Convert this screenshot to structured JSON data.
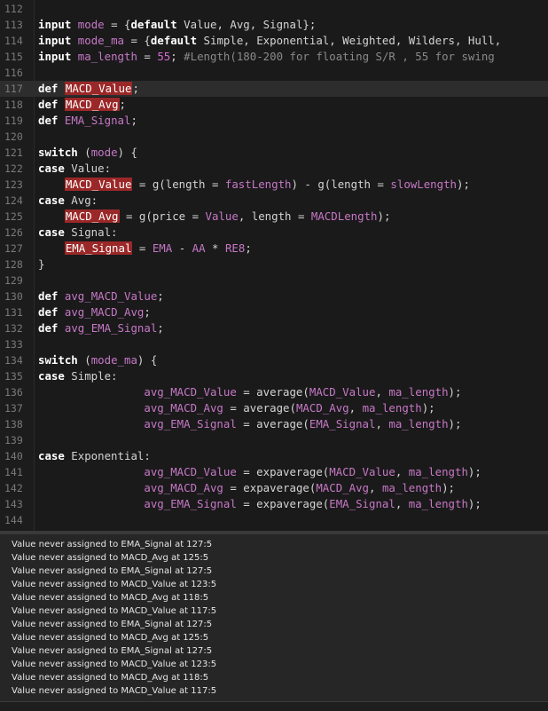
{
  "editor": {
    "lines": [
      {
        "n": "112",
        "segs": []
      },
      {
        "n": "113",
        "segs": [
          {
            "t": "input",
            "c": "kw"
          },
          {
            "t": " "
          },
          {
            "t": "mode",
            "c": "var"
          },
          {
            "t": " = {"
          },
          {
            "t": "default",
            "c": "kw"
          },
          {
            "t": " Value, Avg, Signal};"
          }
        ]
      },
      {
        "n": "114",
        "segs": [
          {
            "t": "input",
            "c": "kw"
          },
          {
            "t": " "
          },
          {
            "t": "mode_ma",
            "c": "var"
          },
          {
            "t": " = {"
          },
          {
            "t": "default",
            "c": "kw"
          },
          {
            "t": " Simple, Exponential, Weighted, Wilders, Hull,"
          }
        ]
      },
      {
        "n": "115",
        "segs": [
          {
            "t": "input",
            "c": "kw"
          },
          {
            "t": " "
          },
          {
            "t": "ma_length",
            "c": "var"
          },
          {
            "t": " = "
          },
          {
            "t": "55",
            "c": "num"
          },
          {
            "t": "; "
          },
          {
            "t": "#Length(180-200 for floating S/R , 55 for swing",
            "c": "com"
          }
        ]
      },
      {
        "n": "116",
        "segs": []
      },
      {
        "n": "117",
        "current": true,
        "segs": [
          {
            "t": "def",
            "c": "kw"
          },
          {
            "t": " "
          },
          {
            "t": "MACD_Value",
            "c": "hl"
          },
          {
            "t": ";"
          }
        ]
      },
      {
        "n": "118",
        "segs": [
          {
            "t": "def",
            "c": "kw"
          },
          {
            "t": " "
          },
          {
            "t": "MACD_Avg",
            "c": "hl"
          },
          {
            "t": ";"
          }
        ]
      },
      {
        "n": "119",
        "segs": [
          {
            "t": "def",
            "c": "kw"
          },
          {
            "t": " "
          },
          {
            "t": "EMA_Signal",
            "c": "var"
          },
          {
            "t": ";"
          }
        ]
      },
      {
        "n": "120",
        "segs": []
      },
      {
        "n": "121",
        "segs": [
          {
            "t": "switch",
            "c": "kw"
          },
          {
            "t": " ("
          },
          {
            "t": "mode",
            "c": "var"
          },
          {
            "t": ") {"
          }
        ]
      },
      {
        "n": "122",
        "segs": [
          {
            "t": "case",
            "c": "kw"
          },
          {
            "t": " Value:"
          }
        ]
      },
      {
        "n": "123",
        "segs": [
          {
            "t": "    "
          },
          {
            "t": "MACD_Value",
            "c": "hl"
          },
          {
            "t": " = g(length = "
          },
          {
            "t": "fastLength",
            "c": "var"
          },
          {
            "t": ") - g(length = "
          },
          {
            "t": "slowLength",
            "c": "var"
          },
          {
            "t": ");"
          }
        ]
      },
      {
        "n": "124",
        "segs": [
          {
            "t": "case",
            "c": "kw"
          },
          {
            "t": " Avg:"
          }
        ]
      },
      {
        "n": "125",
        "segs": [
          {
            "t": "    "
          },
          {
            "t": "MACD_Avg",
            "c": "hl"
          },
          {
            "t": " = g(price = "
          },
          {
            "t": "Value",
            "c": "var"
          },
          {
            "t": ", length = "
          },
          {
            "t": "MACDLength",
            "c": "var"
          },
          {
            "t": ");"
          }
        ]
      },
      {
        "n": "126",
        "segs": [
          {
            "t": "case",
            "c": "kw"
          },
          {
            "t": " Signal:"
          }
        ]
      },
      {
        "n": "127",
        "segs": [
          {
            "t": "    "
          },
          {
            "t": "EMA_Signal",
            "c": "hl"
          },
          {
            "t": " = "
          },
          {
            "t": "EMA",
            "c": "var"
          },
          {
            "t": " - "
          },
          {
            "t": "AA",
            "c": "var"
          },
          {
            "t": " * "
          },
          {
            "t": "RE8",
            "c": "var"
          },
          {
            "t": ";"
          }
        ]
      },
      {
        "n": "128",
        "segs": [
          {
            "t": "}"
          }
        ]
      },
      {
        "n": "129",
        "segs": []
      },
      {
        "n": "130",
        "segs": [
          {
            "t": "def",
            "c": "kw"
          },
          {
            "t": " "
          },
          {
            "t": "avg_MACD_Value",
            "c": "var"
          },
          {
            "t": ";"
          }
        ]
      },
      {
        "n": "131",
        "segs": [
          {
            "t": "def",
            "c": "kw"
          },
          {
            "t": " "
          },
          {
            "t": "avg_MACD_Avg",
            "c": "var"
          },
          {
            "t": ";"
          }
        ]
      },
      {
        "n": "132",
        "segs": [
          {
            "t": "def",
            "c": "kw"
          },
          {
            "t": " "
          },
          {
            "t": "avg_EMA_Signal",
            "c": "var"
          },
          {
            "t": ";"
          }
        ]
      },
      {
        "n": "133",
        "segs": []
      },
      {
        "n": "134",
        "segs": [
          {
            "t": "switch",
            "c": "kw"
          },
          {
            "t": " ("
          },
          {
            "t": "mode_ma",
            "c": "var"
          },
          {
            "t": ") {"
          }
        ]
      },
      {
        "n": "135",
        "segs": [
          {
            "t": "case",
            "c": "kw"
          },
          {
            "t": " Simple:"
          }
        ]
      },
      {
        "n": "136",
        "segs": [
          {
            "t": "                "
          },
          {
            "t": "avg_MACD_Value",
            "c": "var"
          },
          {
            "t": " = average("
          },
          {
            "t": "MACD_Value",
            "c": "var"
          },
          {
            "t": ", "
          },
          {
            "t": "ma_length",
            "c": "var"
          },
          {
            "t": ");"
          }
        ]
      },
      {
        "n": "137",
        "segs": [
          {
            "t": "                "
          },
          {
            "t": "avg_MACD_Avg",
            "c": "var"
          },
          {
            "t": " = average("
          },
          {
            "t": "MACD_Avg",
            "c": "var"
          },
          {
            "t": ", "
          },
          {
            "t": "ma_length",
            "c": "var"
          },
          {
            "t": ");"
          }
        ]
      },
      {
        "n": "138",
        "segs": [
          {
            "t": "                "
          },
          {
            "t": "avg_EMA_Signal",
            "c": "var"
          },
          {
            "t": " = average("
          },
          {
            "t": "EMA_Signal",
            "c": "var"
          },
          {
            "t": ", "
          },
          {
            "t": "ma_length",
            "c": "var"
          },
          {
            "t": ");"
          }
        ]
      },
      {
        "n": "139",
        "segs": []
      },
      {
        "n": "140",
        "segs": [
          {
            "t": "case",
            "c": "kw"
          },
          {
            "t": " Exponential:"
          }
        ]
      },
      {
        "n": "141",
        "segs": [
          {
            "t": "                "
          },
          {
            "t": "avg_MACD_Value",
            "c": "var"
          },
          {
            "t": " = expaverage("
          },
          {
            "t": "MACD_Value",
            "c": "var"
          },
          {
            "t": ", "
          },
          {
            "t": "ma_length",
            "c": "var"
          },
          {
            "t": ");"
          }
        ]
      },
      {
        "n": "142",
        "segs": [
          {
            "t": "                "
          },
          {
            "t": "avg_MACD_Avg",
            "c": "var"
          },
          {
            "t": " = expaverage("
          },
          {
            "t": "MACD_Avg",
            "c": "var"
          },
          {
            "t": ", "
          },
          {
            "t": "ma_length",
            "c": "var"
          },
          {
            "t": ");"
          }
        ]
      },
      {
        "n": "143",
        "segs": [
          {
            "t": "                "
          },
          {
            "t": "avg_EMA_Signal",
            "c": "var"
          },
          {
            "t": " = expaverage("
          },
          {
            "t": "EMA_Signal",
            "c": "var"
          },
          {
            "t": ", "
          },
          {
            "t": "ma_length",
            "c": "var"
          },
          {
            "t": ");"
          }
        ]
      },
      {
        "n": "144",
        "segs": []
      }
    ]
  },
  "messages": {
    "items": [
      "Value never assigned to EMA_Signal at 127:5",
      "Value never assigned to MACD_Avg at 125:5",
      "Value never assigned to EMA_Signal at 127:5",
      "Value never assigned to MACD_Value at 123:5",
      "Value never assigned to MACD_Avg at 118:5",
      "Value never assigned to MACD_Value at 117:5",
      "Value never assigned to EMA_Signal at 127:5",
      "Value never assigned to MACD_Avg at 125:5",
      "Value never assigned to EMA_Signal at 127:5",
      "Value never assigned to MACD_Value at 123:5",
      "Value never assigned to MACD_Avg at 118:5",
      "Value never assigned to MACD_Value at 117:5"
    ]
  }
}
